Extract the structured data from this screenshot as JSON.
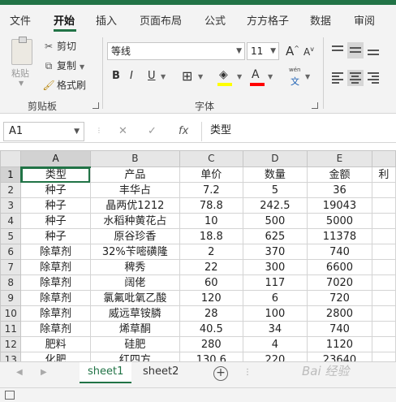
{
  "menu_tabs": [
    "文件",
    "开始",
    "插入",
    "页面布局",
    "公式",
    "方方格子",
    "数据",
    "审阅"
  ],
  "active_tab": "开始",
  "clipboard": {
    "paste": "粘贴",
    "cut": "剪切",
    "copy": "复制",
    "format_painter": "格式刷",
    "group_label": "剪贴板"
  },
  "font": {
    "name": "等线",
    "size": "11",
    "group_label": "字体",
    "grow_label": "A",
    "shrink_label": "A",
    "bold": "B",
    "italic": "I",
    "underline": "U",
    "wen_label": "wén",
    "wen_char": "文",
    "fill_color": "#FFFF00",
    "font_color": "#FF0000"
  },
  "formula_bar": {
    "name_box": "A1",
    "fx": "fx",
    "content": "类型"
  },
  "columns": [
    "A",
    "B",
    "C",
    "D",
    "E",
    ""
  ],
  "rows": [
    {
      "n": "1",
      "cells": [
        "类型",
        "产品",
        "单价",
        "数量",
        "金额",
        "利"
      ]
    },
    {
      "n": "2",
      "cells": [
        "种子",
        "丰华占",
        "7.2",
        "5",
        "36",
        ""
      ]
    },
    {
      "n": "3",
      "cells": [
        "种子",
        "晶两优1212",
        "78.8",
        "242.5",
        "19043",
        ""
      ]
    },
    {
      "n": "4",
      "cells": [
        "种子",
        "水稻种黄花占",
        "10",
        "500",
        "5000",
        ""
      ]
    },
    {
      "n": "5",
      "cells": [
        "种子",
        "原谷珍香",
        "18.8",
        "625",
        "11378",
        ""
      ]
    },
    {
      "n": "6",
      "cells": [
        "除草剂",
        "32%苄嘧磺隆",
        "2",
        "370",
        "740",
        ""
      ]
    },
    {
      "n": "7",
      "cells": [
        "除草剂",
        "稗秀",
        "22",
        "300",
        "6600",
        ""
      ]
    },
    {
      "n": "8",
      "cells": [
        "除草剂",
        "阔佬",
        "60",
        "117",
        "7020",
        ""
      ]
    },
    {
      "n": "9",
      "cells": [
        "除草剂",
        "氯氟吡氧乙酸",
        "120",
        "6",
        "720",
        ""
      ]
    },
    {
      "n": "10",
      "cells": [
        "除草剂",
        "威远草铵膦",
        "28",
        "100",
        "2800",
        ""
      ]
    },
    {
      "n": "11",
      "cells": [
        "除草剂",
        "烯草酮",
        "40.5",
        "34",
        "740",
        ""
      ]
    },
    {
      "n": "12",
      "cells": [
        "肥料",
        "硅肥",
        "280",
        "4",
        "1120",
        ""
      ]
    },
    {
      "n": "13",
      "cells": [
        "化肥",
        "红四方",
        "130.6",
        "220",
        "23640",
        ""
      ]
    }
  ],
  "sheets": [
    "sheet1",
    "sheet2"
  ],
  "active_sheet": "sheet1",
  "add_sheet": "+",
  "watermark": "Bai 经验",
  "accent_color": "#217346"
}
